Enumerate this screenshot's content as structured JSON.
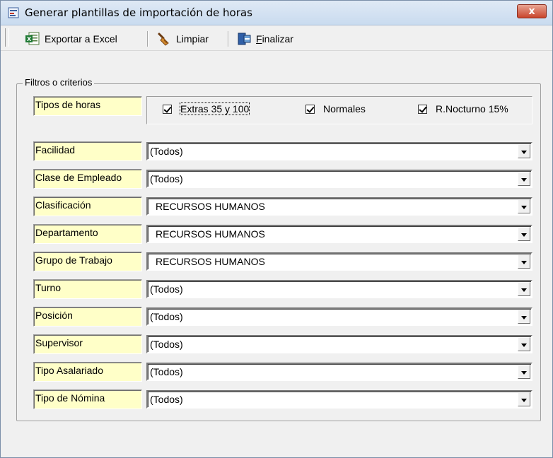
{
  "window": {
    "title": "Generar plantillas de importación de horas",
    "close_label": "x"
  },
  "toolbar": {
    "export_label": "Exportar a Excel",
    "clear_label": "Limpiar",
    "finish_prefix": "",
    "finish_underlined": "F",
    "finish_rest": "inalizar"
  },
  "filters": {
    "legend": "Filtros o criterios",
    "hours_label": "Tipos de horas",
    "hours_options": [
      {
        "label": "Extras 35 y 100",
        "checked": true
      },
      {
        "label": "Normales",
        "checked": true
      },
      {
        "label": "R.Nocturno 15%",
        "checked": true
      }
    ],
    "rows": [
      {
        "label": "Facilidad",
        "value": "(Todos)"
      },
      {
        "label": "Clase de Empleado",
        "value": "(Todos)"
      },
      {
        "label": "Clasificación",
        "value": "RECURSOS HUMANOS"
      },
      {
        "label": "Departamento",
        "value": "RECURSOS HUMANOS"
      },
      {
        "label": "Grupo de Trabajo",
        "value": "RECURSOS HUMANOS"
      },
      {
        "label": "Turno",
        "value": "(Todos)"
      },
      {
        "label": "Posición",
        "value": "(Todos)"
      },
      {
        "label": "Supervisor",
        "value": "(Todos)"
      },
      {
        "label": "Tipo Asalariado",
        "value": "(Todos)"
      },
      {
        "label": "Tipo de Nómina",
        "value": "(Todos)"
      }
    ]
  }
}
